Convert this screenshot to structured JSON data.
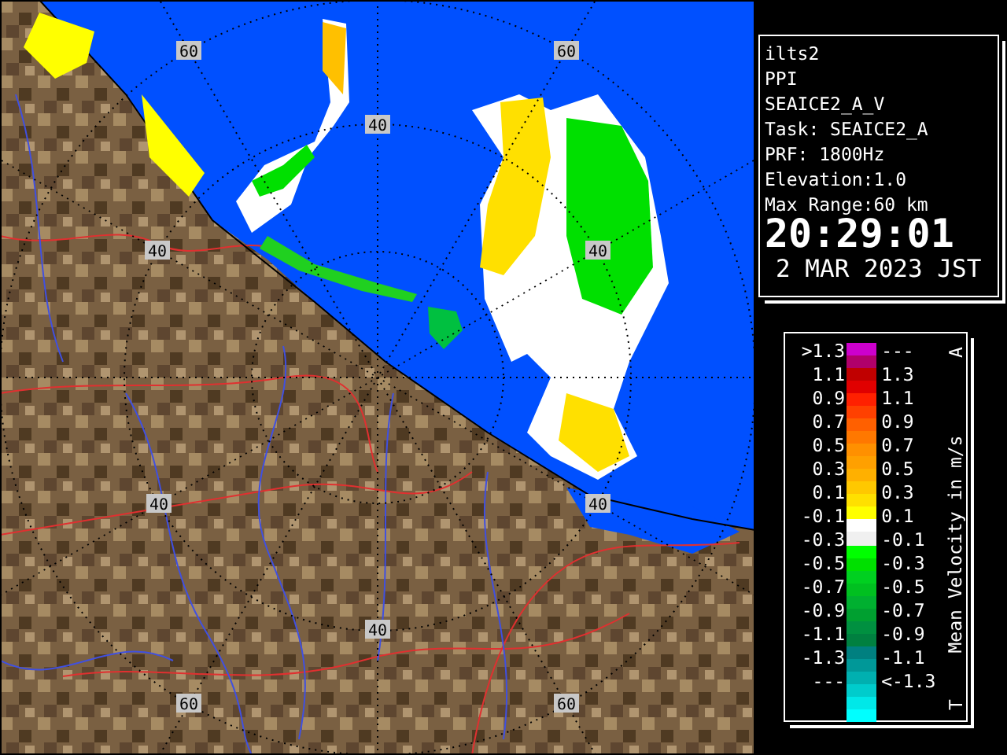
{
  "map": {
    "range_labels": [
      "60",
      "60",
      "40",
      "40",
      "40",
      "40",
      "40",
      "40",
      "60",
      "60"
    ]
  },
  "info": {
    "lines": [
      "ilts2",
      "PPI",
      "SEAICE2_A_V",
      "Task: SEAICE2_A",
      "PRF: 1800Hz",
      "Elevation:1.0",
      "Max Range:60 km"
    ],
    "time": "20:29:01",
    "date": "2 MAR 2023 JST"
  },
  "legend": {
    "title": "Mean Velocity in m/s",
    "top_mark": "A",
    "bottom_mark": "T",
    "rows": [
      {
        "low": ">1.3",
        "high": "---"
      },
      {
        "low": "1.1",
        "high": "1.3"
      },
      {
        "low": "0.9",
        "high": "1.1"
      },
      {
        "low": "0.7",
        "high": "0.9"
      },
      {
        "low": "0.5",
        "high": "0.7"
      },
      {
        "low": "0.3",
        "high": "0.5"
      },
      {
        "low": "0.1",
        "high": "0.3"
      },
      {
        "low": "-0.1",
        "high": "0.1"
      },
      {
        "low": "-0.3",
        "high": "-0.1"
      },
      {
        "low": "-0.5",
        "high": "-0.3"
      },
      {
        "low": "-0.7",
        "high": "-0.5"
      },
      {
        "low": "-0.9",
        "high": "-0.7"
      },
      {
        "low": "-1.1",
        "high": "-0.9"
      },
      {
        "low": "-1.3",
        "high": "-1.1"
      },
      {
        "low": "---",
        "high": "<-1.3"
      }
    ],
    "swatches": [
      {
        "color": "#cc00cc"
      },
      {
        "color": "#b0006a"
      },
      {
        "color": "#c00000"
      },
      {
        "color": "#e00000"
      },
      {
        "color": "#ff2000"
      },
      {
        "color": "#ff4000"
      },
      {
        "color": "#ff6000"
      },
      {
        "color": "#ff7800"
      },
      {
        "color": "#ff9000"
      },
      {
        "color": "#ffa000"
      },
      {
        "color": "#ffb000"
      },
      {
        "color": "#ffc800"
      },
      {
        "color": "#ffe000"
      },
      {
        "color": "#ffff00"
      },
      {
        "color": "#ffffff"
      },
      {
        "color": "#f0f0f0"
      },
      {
        "color": "#00ff00"
      },
      {
        "color": "#00e000"
      },
      {
        "color": "#00d020"
      },
      {
        "color": "#00c020"
      },
      {
        "color": "#00b030"
      },
      {
        "color": "#00a030"
      },
      {
        "color": "#009040"
      },
      {
        "color": "#008040"
      },
      {
        "color": "#008080"
      },
      {
        "color": "#009898"
      },
      {
        "color": "#00b0b0"
      },
      {
        "color": "#00cccc"
      },
      {
        "color": "#00e8e8"
      },
      {
        "color": "#00ffff"
      }
    ]
  }
}
